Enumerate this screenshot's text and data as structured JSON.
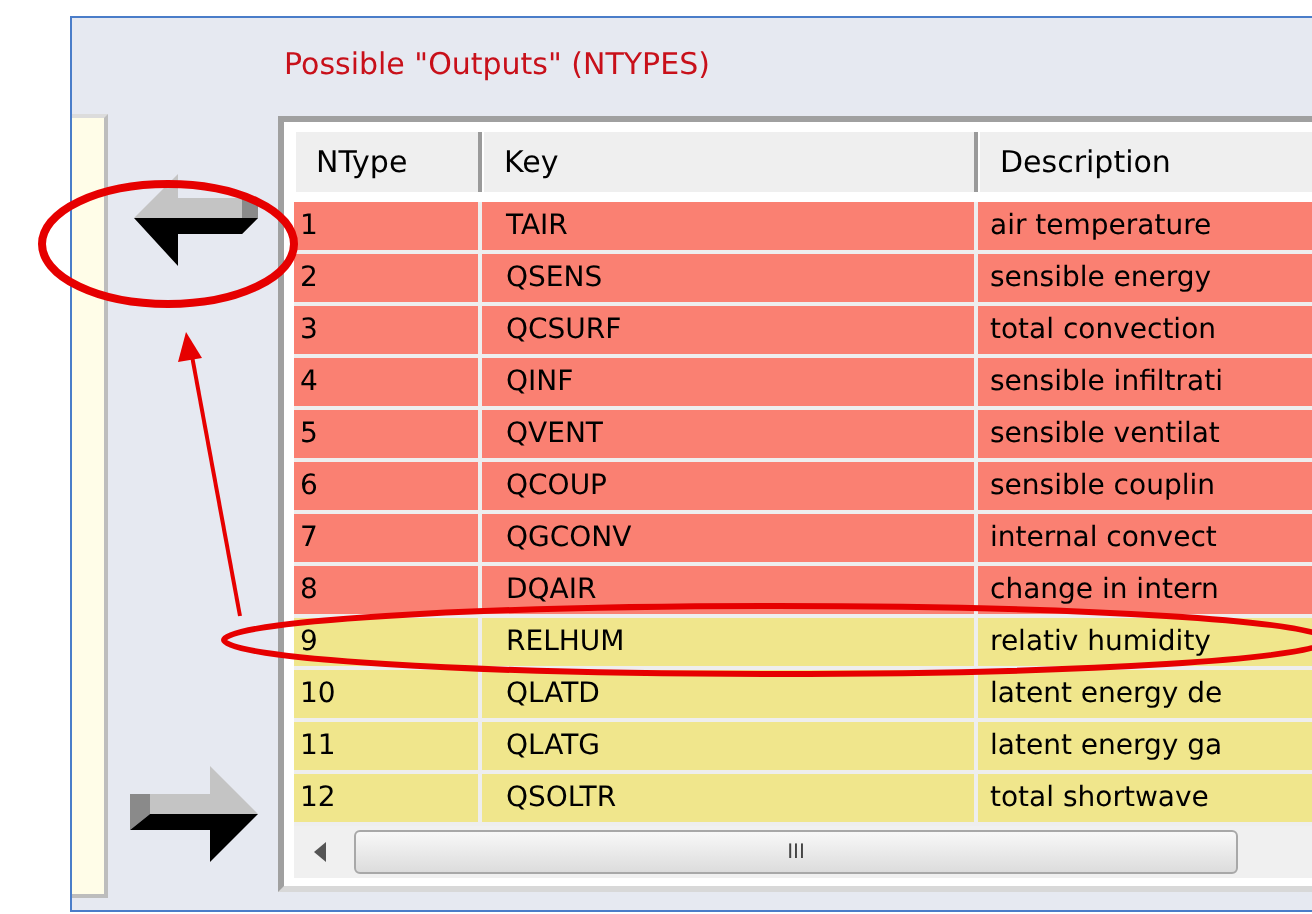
{
  "panel": {
    "title": "Possible \"Outputs\" (NTYPES)"
  },
  "columns": [
    "NType",
    "Key",
    "Description"
  ],
  "rows": [
    {
      "ntype": "1",
      "key": "TAIR",
      "description": "air temperature",
      "color": "#fa8072"
    },
    {
      "ntype": "2",
      "key": "QSENS",
      "description": "sensible energy",
      "color": "#fa8072"
    },
    {
      "ntype": "3",
      "key": "QCSURF",
      "description": "total convection",
      "color": "#fa8072"
    },
    {
      "ntype": "4",
      "key": "QINF",
      "description": "sensible infiltrati",
      "color": "#fa8072"
    },
    {
      "ntype": "5",
      "key": "QVENT",
      "description": "sensible ventilat",
      "color": "#fa8072"
    },
    {
      "ntype": "6",
      "key": "QCOUP",
      "description": "sensible couplin",
      "color": "#fa8072"
    },
    {
      "ntype": "7",
      "key": "QGCONV",
      "description": "internal convect",
      "color": "#fa8072"
    },
    {
      "ntype": "8",
      "key": "DQAIR",
      "description": "change in intern",
      "color": "#fa8072"
    },
    {
      "ntype": "9",
      "key": "RELHUM",
      "description": "relativ humidity",
      "color": "#f0e68c"
    },
    {
      "ntype": "10",
      "key": "QLATD",
      "description": "latent energy de",
      "color": "#f0e68c"
    },
    {
      "ntype": "11",
      "key": "QLATG",
      "description": "latent energy ga",
      "color": "#f0e68c"
    },
    {
      "ntype": "12",
      "key": "QSOLTR",
      "description": "total shortwave",
      "color": "#f0e68c"
    }
  ],
  "scrollbar": {
    "grip": "III"
  }
}
